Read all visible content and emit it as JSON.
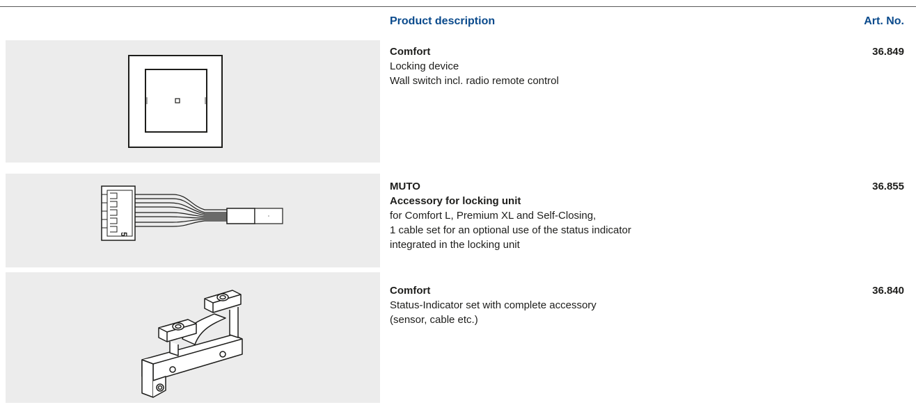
{
  "header": {
    "description_label": "Product description",
    "art_no_label": "Art. No."
  },
  "colors": {
    "header_text": "#0a4a8c",
    "image_background": "#ececec",
    "body_text": "#1d1d1b"
  },
  "products": [
    {
      "title": "Comfort",
      "lines": [
        "Locking device",
        "Wall switch incl. radio remote control"
      ],
      "art_no": "36.849",
      "image": "wall-switch-icon"
    },
    {
      "title": "MUTO",
      "subtitle": "Accessory for locking unit",
      "lines": [
        "for Comfort L, Premium XL and Self-Closing,",
        "1 cable set for an optional use of the status indicator",
        "integrated in the locking unit"
      ],
      "art_no": "36.855",
      "image": "cable-set-icon",
      "image_label": "5"
    },
    {
      "title": "Comfort",
      "lines": [
        "Status-Indicator set with complete accessory",
        "(sensor, cable etc.)"
      ],
      "art_no": "36.840",
      "image": "status-indicator-icon"
    }
  ]
}
